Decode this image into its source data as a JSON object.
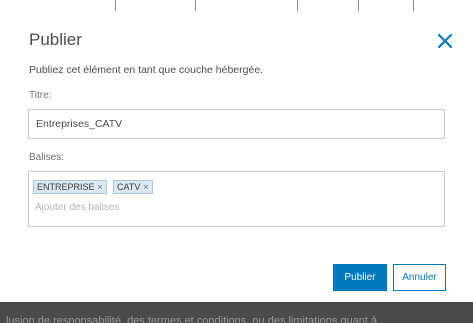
{
  "dialog": {
    "title": "Publier",
    "intro": "Publiez cet élément en tant que couche hébergée.",
    "close_icon": "close-icon",
    "accent_color": "#0079c1"
  },
  "fields": {
    "title_label": "Titre:",
    "title_value": "Entreprises_CATV",
    "tags_label": "Balises:",
    "tags": [
      {
        "label": "ENTREPRISE",
        "remove": "×"
      },
      {
        "label": "CATV",
        "remove": "×"
      }
    ],
    "tags_placeholder": "Ajouter des balises"
  },
  "buttons": {
    "publish_label": "Publier",
    "cancel_label": "Annuler"
  },
  "background": {
    "bottom_text": "lusion de responsabilité, des termes et conditions, ou des limitations quant à"
  }
}
